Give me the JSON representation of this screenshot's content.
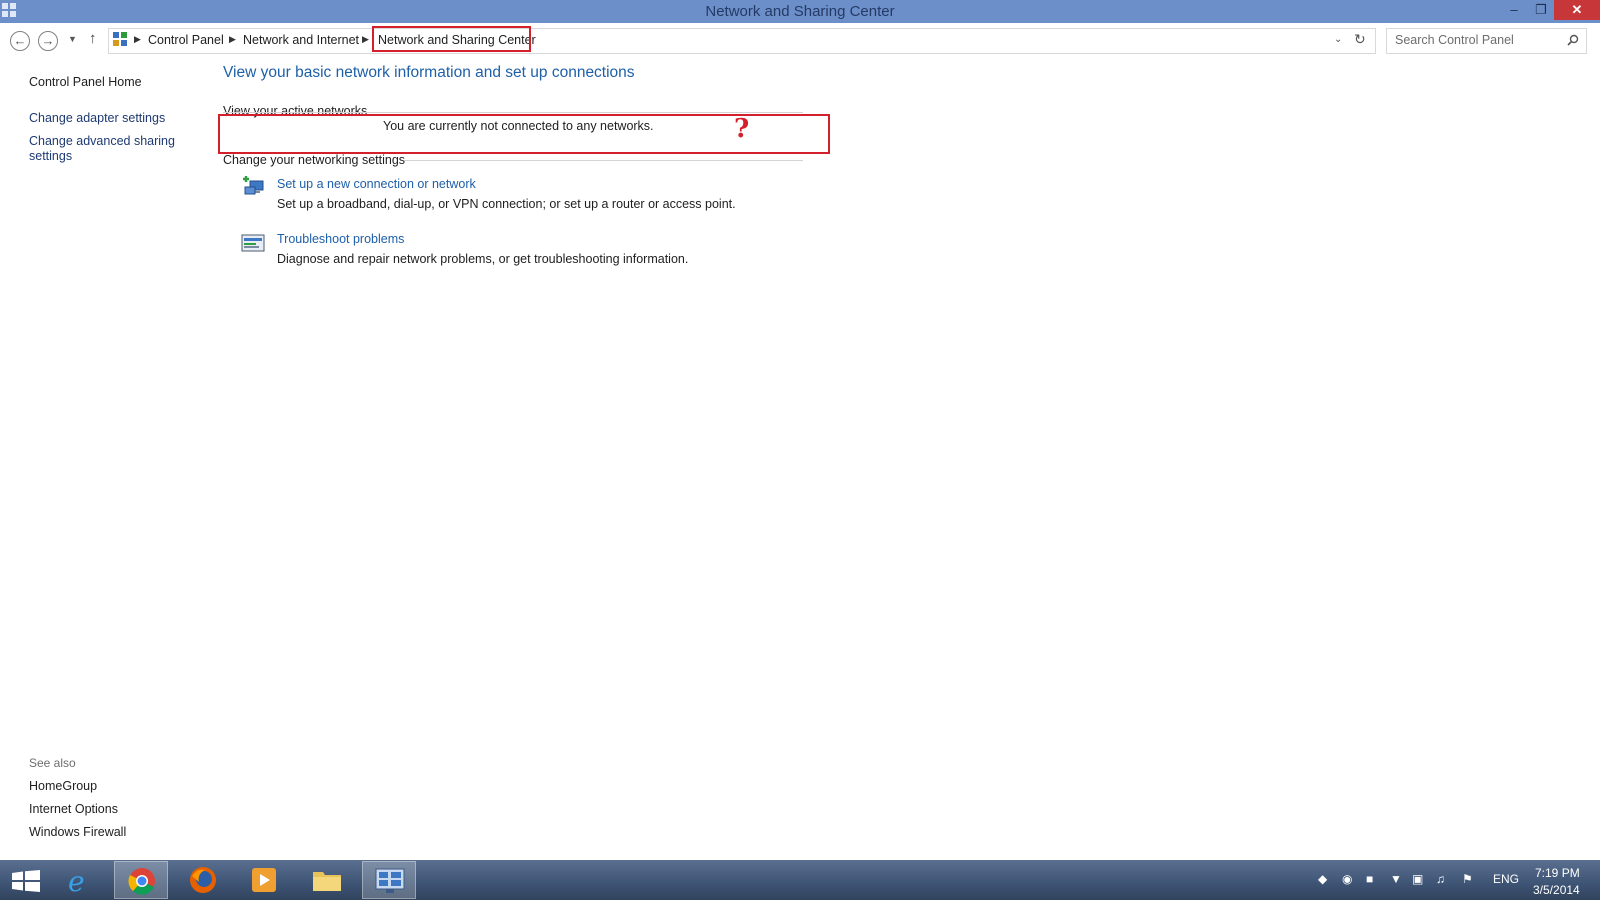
{
  "window": {
    "title": "Network and Sharing Center",
    "minimize_icon": "minimize-icon",
    "restore_icon": "restore-icon",
    "close_icon": "close-icon"
  },
  "addressbar": {
    "breadcrumbs": [
      "Control Panel",
      "Network and Internet",
      "Network and Sharing Center"
    ],
    "search_placeholder": "Search Control Panel"
  },
  "sidebar": {
    "links": [
      "Control Panel Home",
      "Change adapter settings",
      "Change advanced sharing",
      "settings"
    ],
    "see_also_label": "See also",
    "see_also": [
      "HomeGroup",
      "Internet Options",
      "Windows Firewall"
    ]
  },
  "main": {
    "heading": "View your basic network information and set up connections",
    "active_networks_label": "View your active networks",
    "status_message": "You are currently not connected to any networks.",
    "annotation_mark": "?",
    "settings_label": "Change your networking settings",
    "tasks": [
      {
        "link": "Set up a new connection or network",
        "desc": "Set up a broadband, dial-up, or VPN connection; or set up a router or access point.",
        "icon": "new-connection-icon"
      },
      {
        "link": "Troubleshoot problems",
        "desc": "Diagnose and repair network problems, or get troubleshooting information.",
        "icon": "troubleshoot-icon"
      }
    ]
  },
  "taskbar": {
    "apps": [
      "start-button",
      "internet-explorer-icon",
      "chrome-icon",
      "firefox-icon",
      "media-player-icon",
      "file-explorer-icon",
      "control-panel-icon"
    ],
    "language": "ENG",
    "time": "7:19 PM",
    "date": "3/5/2014"
  },
  "colors": {
    "titlebar": "#6d8fc9",
    "accent_link": "#1e5fa8",
    "highlight_red": "#d4202a",
    "close_button": "#c7373a"
  }
}
